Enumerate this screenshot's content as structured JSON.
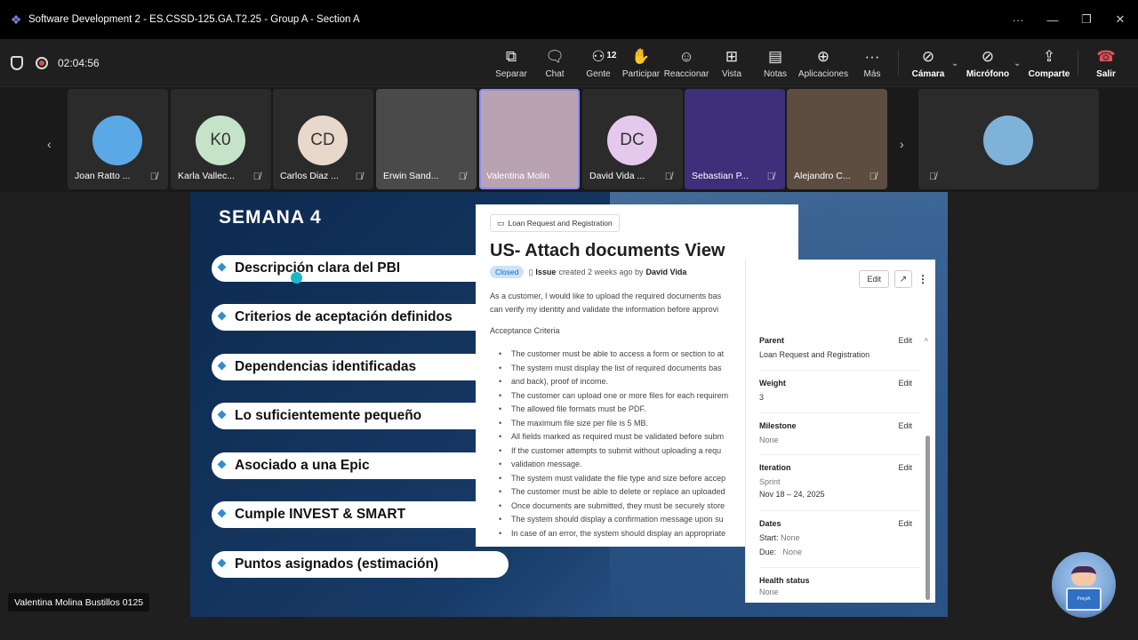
{
  "window": {
    "title": "Software Development 2 - ES.CSSD-125.GA.T2.25 - Group A - Section A",
    "controls": [
      "···",
      "—",
      "❐",
      "✕"
    ]
  },
  "meeting": {
    "timer": "02:04:56",
    "buttons": [
      {
        "label": "Separar",
        "icon": "pop-out-icon"
      },
      {
        "label": "Chat",
        "icon": "chat-icon"
      },
      {
        "label": "Gente",
        "icon": "people-icon",
        "badge": "12"
      },
      {
        "label": "Participar",
        "icon": "raise-hand-icon"
      },
      {
        "label": "Reaccionar",
        "icon": "react-icon"
      },
      {
        "label": "Vista",
        "icon": "view-icon"
      },
      {
        "label": "Notas",
        "icon": "notes-icon"
      },
      {
        "label": "Aplicaciones",
        "icon": "apps-icon"
      },
      {
        "label": "Más",
        "icon": "more-icon"
      },
      {
        "label": "Cámara",
        "icon": "camera-off-icon"
      },
      {
        "label": "Micrófono",
        "icon": "mic-off-icon"
      },
      {
        "label": "Comparte",
        "icon": "share-icon"
      },
      {
        "label": "Salir",
        "icon": "leave-icon"
      }
    ]
  },
  "participants": [
    {
      "name": "Joan Ratto ...",
      "initials": "",
      "avatar_color": "#5aa9e6"
    },
    {
      "name": "Karla Vallec...",
      "initials": "K0",
      "avatar_color": "#c5e3c8"
    },
    {
      "name": "Carlos Diaz ...",
      "initials": "CD",
      "avatar_color": "#e8d8cc"
    },
    {
      "name": "Erwin Sand...",
      "initials": "",
      "avatar_color": "#bdbdbd"
    },
    {
      "name": "Valentina Molin...",
      "initials": "",
      "avatar_color": "#d9b8c8"
    },
    {
      "name": "David Vida ...",
      "initials": "DC",
      "avatar_color": "#e5c9ec"
    },
    {
      "name": "Sebastian P...",
      "initials": "",
      "avatar_color": "#5a4aa8"
    },
    {
      "name": "Alejandro C...",
      "initials": "",
      "avatar_color": "#7a6655"
    },
    {
      "name": "",
      "initials": "",
      "avatar_color": "#7fb2d9"
    }
  ],
  "slide": {
    "title": "SEMANA 4",
    "items": [
      "Descripción clara del PBI",
      "Criterios de aceptación definidos",
      "Dependencias identificadas",
      "Lo suficientemente pequeño",
      "Asociado a una Epic",
      "Cumple INVEST & SMART",
      "Puntos asignados (estimación)"
    ]
  },
  "issue": {
    "breadcrumb": "Loan Request and Registration",
    "title": "US- Attach documents View",
    "status": "Closed",
    "type": "Issue",
    "created": "created 2 weeks ago by",
    "author": "David Vida",
    "description_line1": "As a customer, I would like to upload the required documents bas",
    "description_line2": "can verify my identity and validate the information before approvi",
    "acceptance_heading": "Acceptance Criteria",
    "criteria": [
      "The customer must be able to access a form or section to at",
      "The system must display the list of required documents bas",
      "and back), proof of income.",
      "The customer can upload one or more files for each requirem",
      "The allowed file formats must be PDF.",
      "The maximum file size per file is 5 MB.",
      "All fields marked as required must be validated before subm",
      "If the customer attempts to submit without uploading a requ",
      "validation message.",
      "The system must validate the file type and size before accep",
      "The customer must be able to delete or replace an uploaded",
      "Once documents are submitted, they must be securely store",
      "The system should display a confirmation message upon su",
      "In case of an error, the system should display an appropriate"
    ]
  },
  "sidebar": {
    "edit_button": "Edit",
    "parent": {
      "label": "Parent",
      "edit": "Edit",
      "value": "Loan Request and Registration"
    },
    "weight": {
      "label": "Weight",
      "edit": "Edit",
      "value": "3"
    },
    "milestone": {
      "label": "Milestone",
      "edit": "Edit",
      "value": "None"
    },
    "iteration": {
      "label": "Iteration",
      "edit": "Edit",
      "sub": "Sprint",
      "value": "Nov 18 – 24, 2025"
    },
    "dates": {
      "label": "Dates",
      "edit": "Edit",
      "start_label": "Start:",
      "start": "None",
      "due_label": "Due:",
      "due": "None"
    },
    "health": {
      "label": "Health status",
      "value": "None"
    }
  },
  "speaker": "Valentina Molina Bustillos 0125",
  "bot_label": "ProyIA"
}
